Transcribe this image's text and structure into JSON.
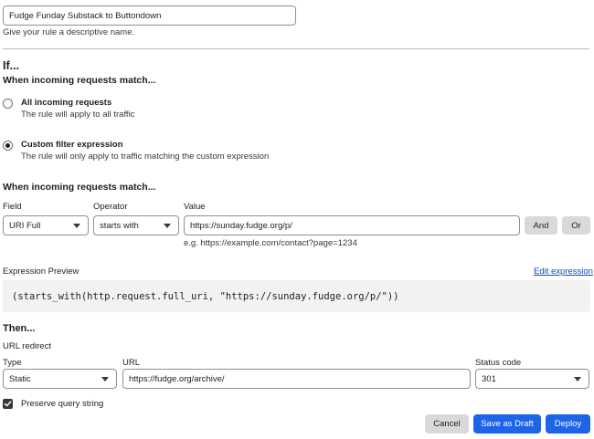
{
  "rule_name": {
    "value": "Fudge Funday Substack to Buttondown",
    "help": "Give your rule a descriptive name."
  },
  "if_section": {
    "title": "If...",
    "subtitle": "When incoming requests match...",
    "options": [
      {
        "label": "All incoming requests",
        "description": "The rule will apply to all traffic",
        "selected": false
      },
      {
        "label": "Custom filter expression",
        "description": "The rule will only apply to traffic matching the custom expression",
        "selected": true
      }
    ]
  },
  "filter": {
    "subtitle": "When incoming requests match...",
    "field_label": "Field",
    "operator_label": "Operator",
    "value_label": "Value",
    "field_value": "URI Full",
    "operator_value": "starts with",
    "value_value": "https://sunday.fudge.org/p/",
    "value_example": "e.g. https://example.com/contact?page=1234",
    "and_label": "And",
    "or_label": "Or"
  },
  "expression": {
    "label": "Expression Preview",
    "edit_label": "Edit expression",
    "code": "(starts_with(http.request.full_uri, \"https://sunday.fudge.org/p/\"))"
  },
  "then_section": {
    "title": "Then...",
    "action": "URL redirect",
    "type_label": "Type",
    "type_value": "Static",
    "url_label": "URL",
    "url_value": "https://fudge.org/archive/",
    "status_label": "Status code",
    "status_value": "301",
    "preserve_label": "Preserve query string",
    "preserve_checked": true
  },
  "footer": {
    "cancel_label": "Cancel",
    "draft_label": "Save as Draft",
    "deploy_label": "Deploy"
  }
}
